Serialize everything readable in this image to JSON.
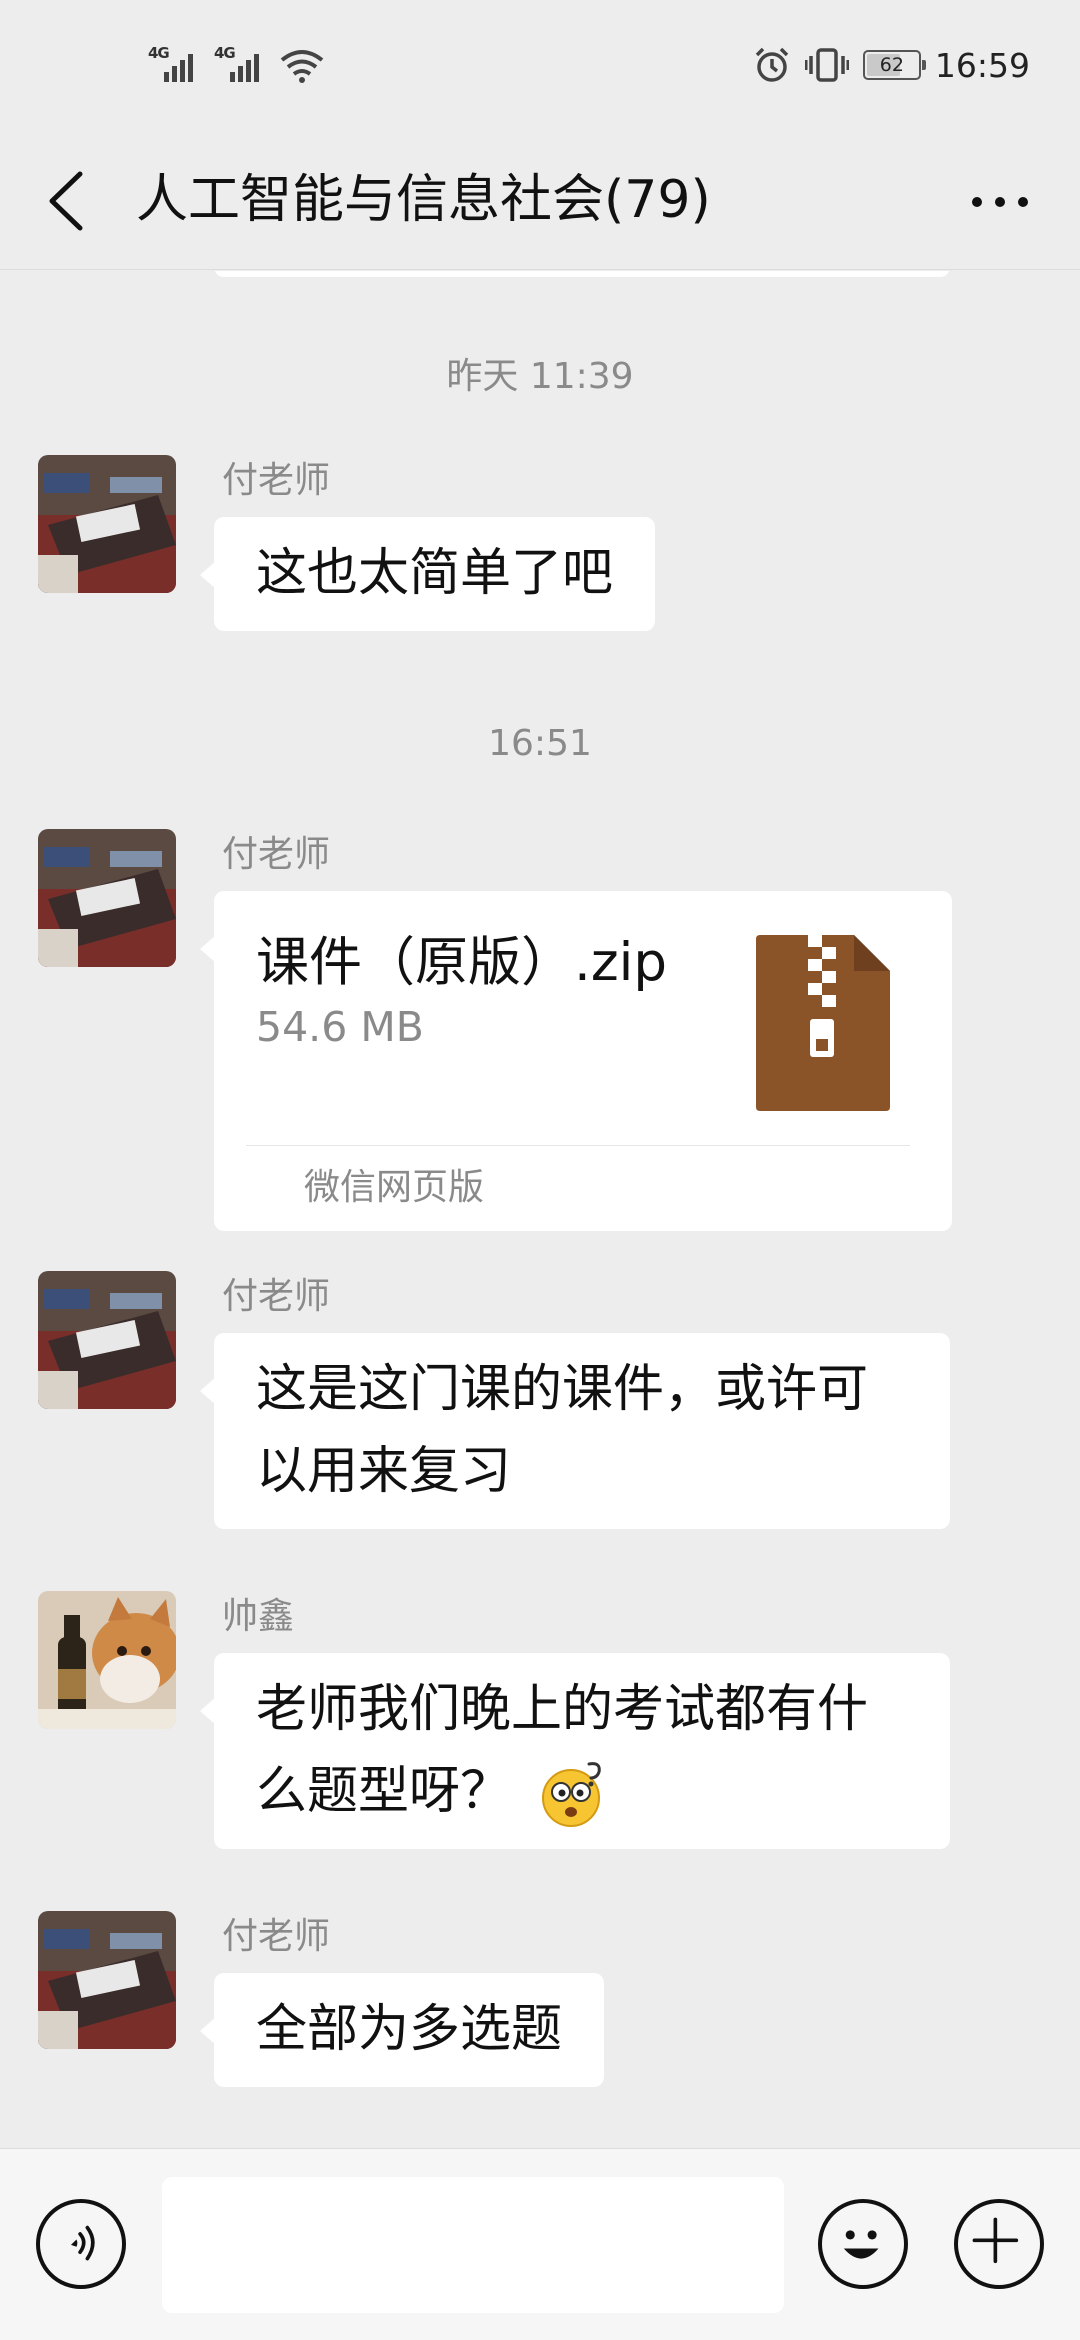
{
  "status_bar": {
    "signal_1": "4G",
    "signal_2": "4G",
    "battery_level": "62",
    "time": "16:59",
    "icons": [
      "alarm-icon",
      "vibrate-icon",
      "wifi-icon"
    ]
  },
  "header": {
    "title": "人工智能与信息社会(79)",
    "back_icon": "chevron-left-icon",
    "more_icon": "more-dots-icon"
  },
  "messages": {
    "time_1": "昨天 11:39",
    "time_2": "16:51",
    "m1": {
      "sender": "付老师",
      "text": "这也太简单了吧"
    },
    "file": {
      "sender": "付老师",
      "name": "课件（原版）.zip",
      "size": "54.6 MB",
      "source": "微信网页版",
      "icon_color": "#8b5428"
    },
    "m3": {
      "sender": "付老师",
      "line1": "这是这门课的课件，或许可",
      "line2": "以用来复习"
    },
    "m4": {
      "sender": "帅鑫",
      "line1": "老师我们晚上的考试都有什",
      "line2": "么题型呀？"
    },
    "m5": {
      "sender": "付老师",
      "text": "全部为多选题"
    }
  },
  "input_bar": {
    "voice_icon": "voice-icon",
    "emoji_icon": "emoji-smile-icon",
    "plus_icon": "plus-circle-icon",
    "value": ""
  },
  "colors": {
    "background": "#ededed",
    "bubble": "#ffffff",
    "meta_text": "#8a8a8a"
  }
}
